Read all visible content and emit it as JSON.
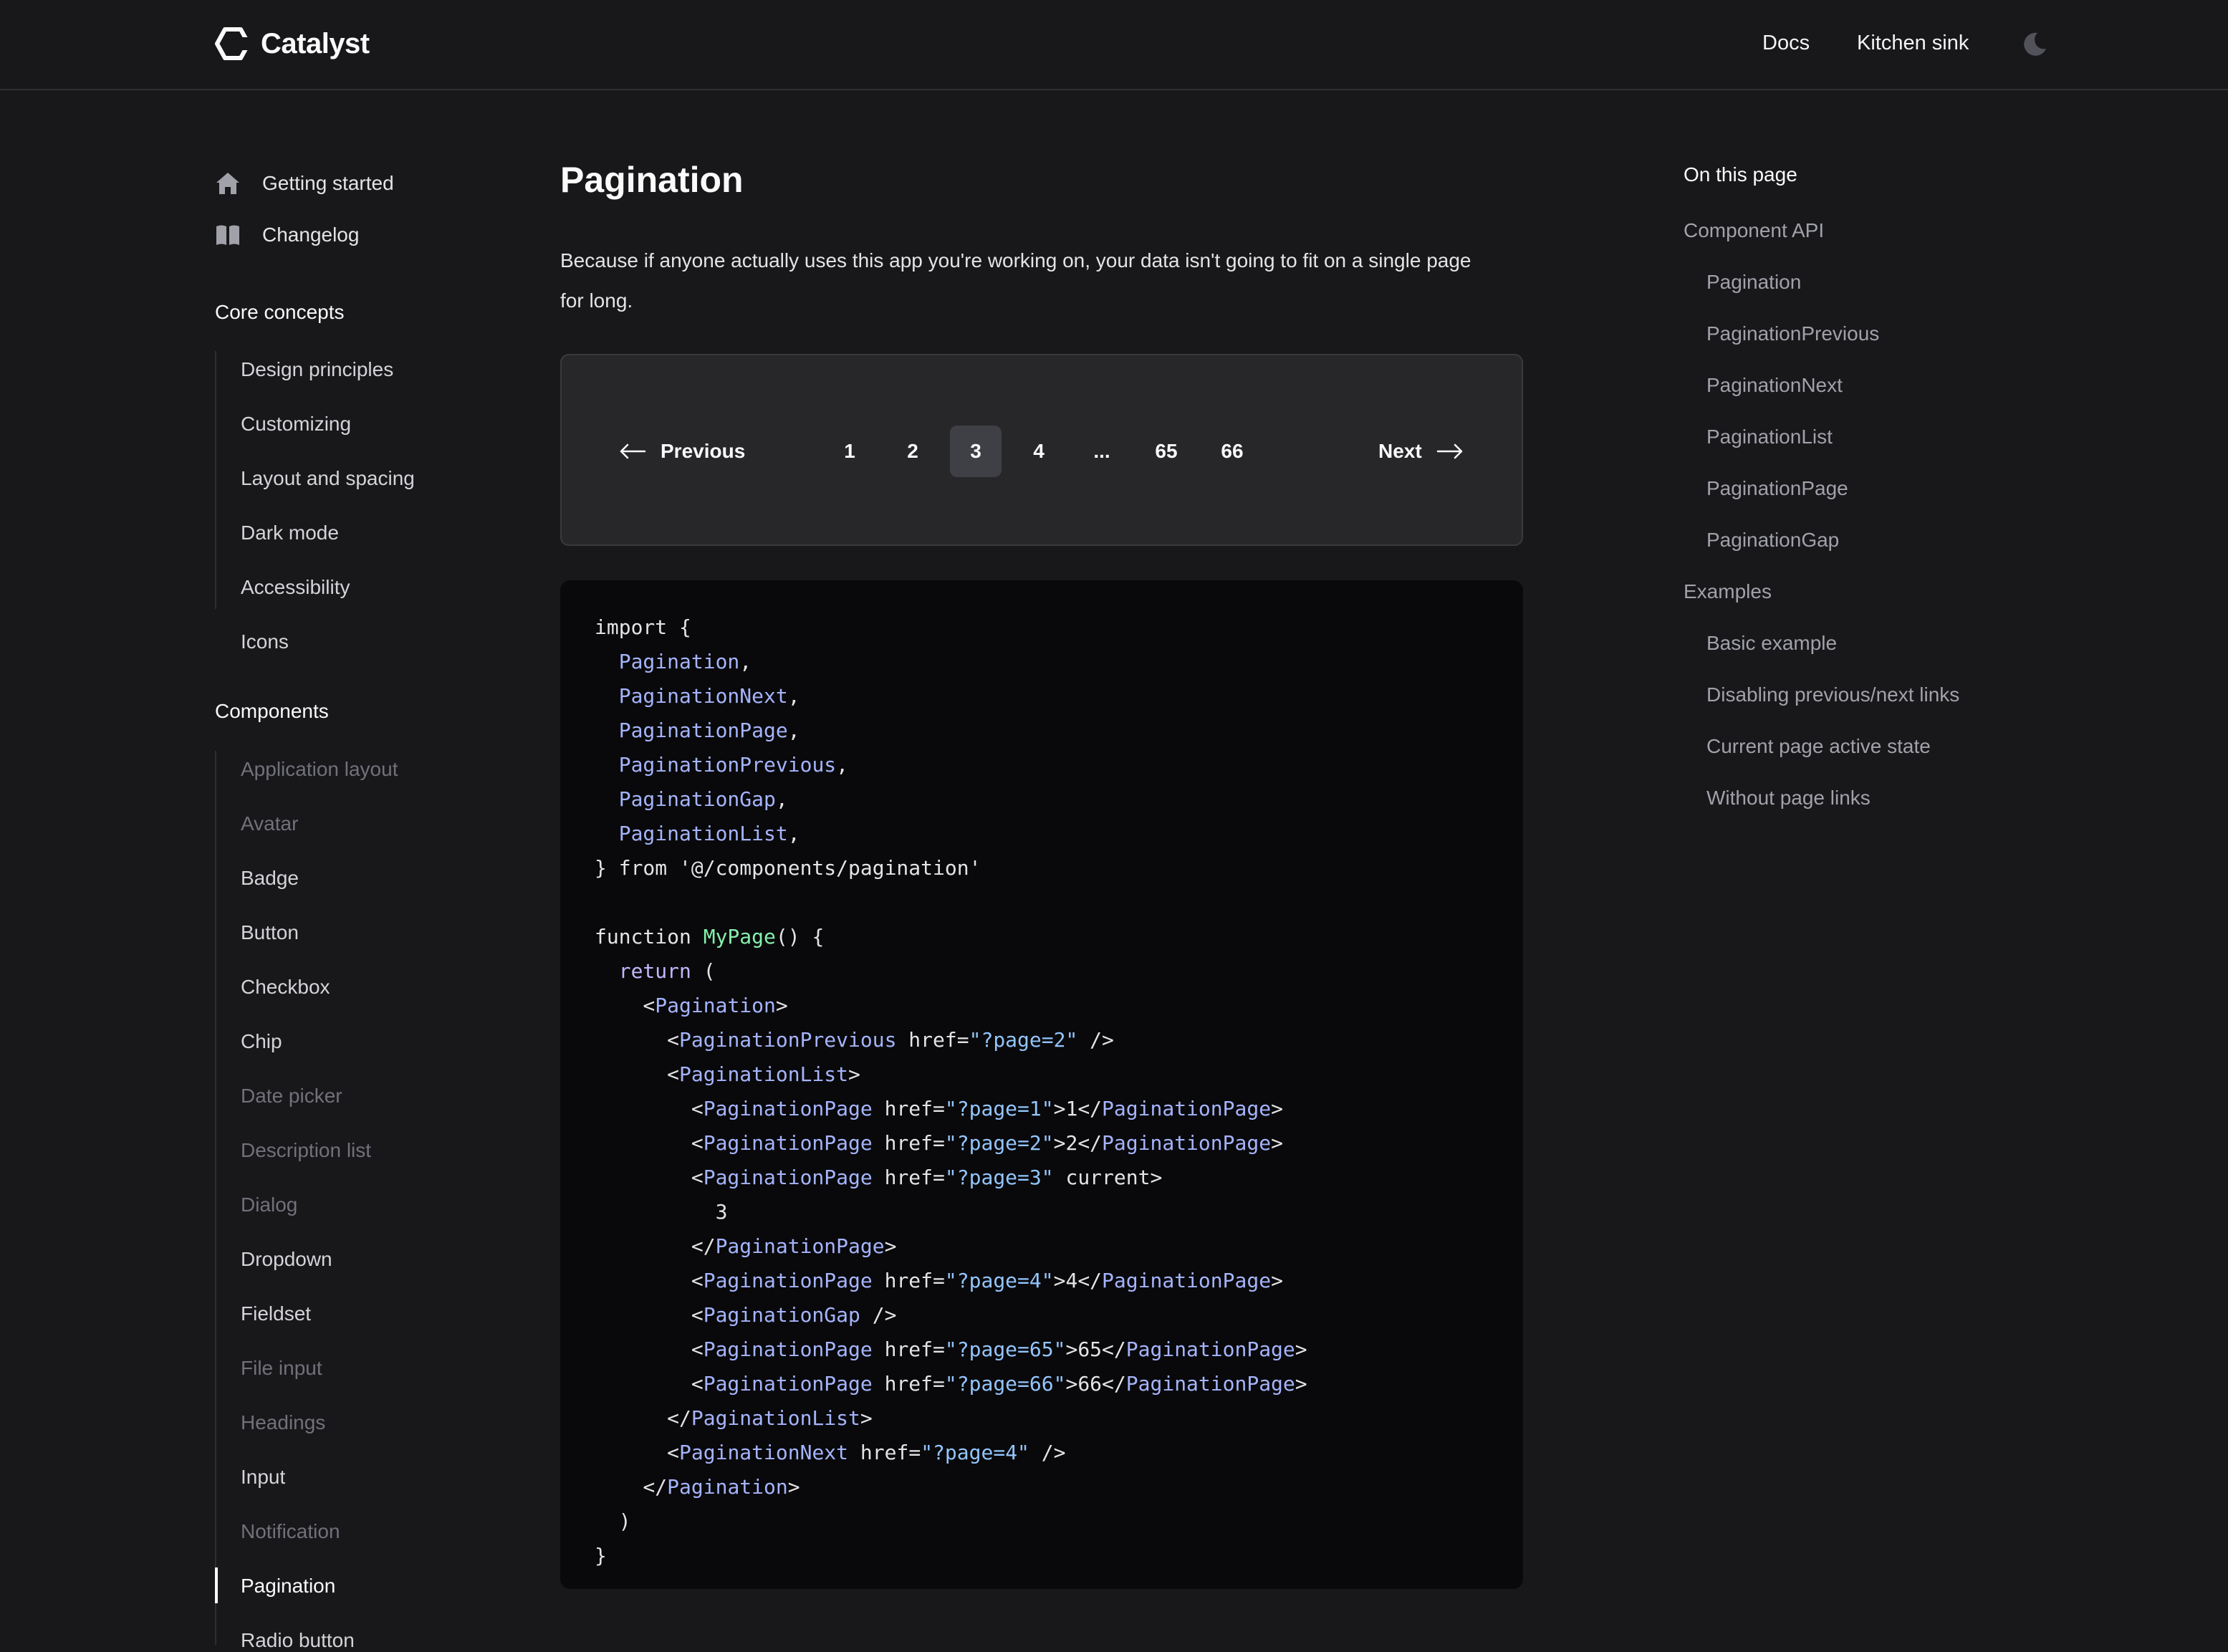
{
  "header": {
    "brand": "Catalyst",
    "nav": [
      "Docs",
      "Kitchen sink"
    ],
    "theme_icon": "moon-icon"
  },
  "sidebar": {
    "top_items": [
      {
        "label": "Getting started",
        "icon": "home-icon"
      },
      {
        "label": "Changelog",
        "icon": "book-icon"
      }
    ],
    "core_title": "Core concepts",
    "core_items": [
      "Design principles",
      "Customizing",
      "Layout and spacing",
      "Dark mode",
      "Accessibility",
      "Icons"
    ],
    "components_title": "Components",
    "component_items": [
      "Application layout",
      "Avatar",
      "Badge",
      "Button",
      "Checkbox",
      "Chip",
      "Date picker",
      "Description list",
      "Dialog",
      "Dropdown",
      "Fieldset",
      "File input",
      "Headings",
      "Input",
      "Notification",
      "Pagination",
      "Radio button"
    ],
    "active_item": "Pagination"
  },
  "main": {
    "title": "Pagination",
    "intro": "Because if anyone actually uses this app you're working on, your data isn't going to fit on a single page for long.",
    "pagination": {
      "previous_label": "Previous",
      "next_label": "Next",
      "pages": [
        "1",
        "2",
        "3",
        "4",
        "...",
        "65",
        "66"
      ],
      "current_page": "3"
    },
    "code_lines": [
      "import {",
      "  Pagination,",
      "  PaginationNext,",
      "  PaginationPage,",
      "  PaginationPrevious,",
      "  PaginationGap,",
      "  PaginationList,",
      "} from '@/components/pagination'",
      "",
      "function MyPage() {",
      "  return (",
      "    <Pagination>",
      "      <PaginationPrevious href=\"?page=2\" />",
      "      <PaginationList>",
      "        <PaginationPage href=\"?page=1\">1</PaginationPage>",
      "        <PaginationPage href=\"?page=2\">2</PaginationPage>",
      "        <PaginationPage href=\"?page=3\" current>",
      "          3",
      "        </PaginationPage>",
      "        <PaginationPage href=\"?page=4\">4</PaginationPage>",
      "        <PaginationGap />",
      "        <PaginationPage href=\"?page=65\">65</PaginationPage>",
      "        <PaginationPage href=\"?page=66\">66</PaginationPage>",
      "      </PaginationList>",
      "      <PaginationNext href=\"?page=4\" />",
      "    </Pagination>",
      "  )",
      "}"
    ]
  },
  "toc": {
    "title": "On this page",
    "items": [
      {
        "label": "Component API",
        "level": 1
      },
      {
        "label": "Pagination",
        "level": 2
      },
      {
        "label": "PaginationPrevious",
        "level": 2
      },
      {
        "label": "PaginationNext",
        "level": 2
      },
      {
        "label": "PaginationList",
        "level": 2
      },
      {
        "label": "PaginationPage",
        "level": 2
      },
      {
        "label": "PaginationGap",
        "level": 2
      },
      {
        "label": "Examples",
        "level": 1
      },
      {
        "label": "Basic example",
        "level": 2
      },
      {
        "label": "Disabling previous/next links",
        "level": 2
      },
      {
        "label": "Current page active state",
        "level": 2
      },
      {
        "label": "Without page links",
        "level": 2
      }
    ]
  },
  "colors": {
    "background": "#18181b",
    "panel": "#27272a",
    "code_bg": "#09090b",
    "code_identifier": "#a5b4fc",
    "code_string": "#93c5fd",
    "code_function": "#86efac"
  }
}
